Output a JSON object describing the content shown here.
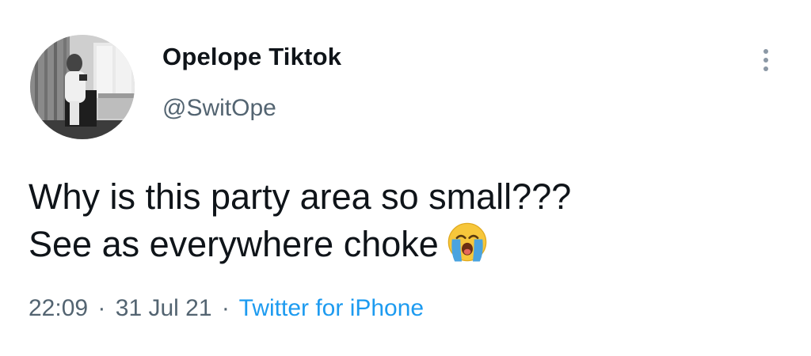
{
  "author": {
    "display_name": "Opelope Tiktok",
    "handle": "@SwitOpe"
  },
  "tweet": {
    "text_line1": "Why is this party area so small???",
    "text_line2": "See as everywhere choke",
    "emoji": "loudly-crying-face"
  },
  "meta": {
    "time": "22:09",
    "separator": "·",
    "date": "31 Jul 21",
    "source": "Twitter for iPhone"
  },
  "icons": {
    "more": "more-vertical-icon"
  },
  "colors": {
    "primary_text": "#0f1419",
    "secondary_text": "#536471",
    "link": "#1d9bf0",
    "emoji_yellow": "#f7c73b",
    "emoji_tear": "#4aa3df"
  }
}
